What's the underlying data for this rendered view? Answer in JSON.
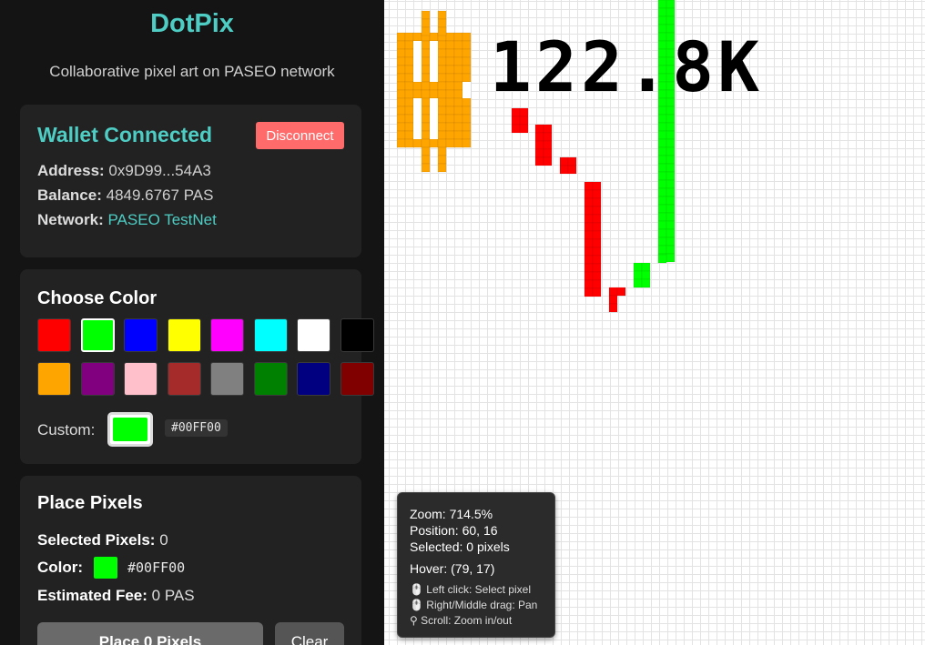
{
  "app": {
    "title": "DotPix",
    "subtitle": "Collaborative pixel art on PASEO network"
  },
  "wallet": {
    "title": "Wallet Connected",
    "disconnect_label": "Disconnect",
    "address_label": "Address:",
    "address_value": "0x9D99...54A3",
    "balance_label": "Balance:",
    "balance_value": "4849.6767 PAS",
    "network_label": "Network:",
    "network_value": "PASEO TestNet"
  },
  "color_picker": {
    "title": "Choose Color",
    "swatches": [
      "#ff0000",
      "#00ff00",
      "#0000ff",
      "#ffff00",
      "#ff00ff",
      "#00ffff",
      "#ffffff",
      "#000000",
      "#ffa500",
      "#800080",
      "#ffc0cb",
      "#a52a2a",
      "#808080",
      "#008000",
      "#000080",
      "#800000"
    ],
    "selected_color": "#00ff00",
    "custom_label": "Custom:",
    "custom_hex": "#00FF00"
  },
  "place": {
    "title": "Place Pixels",
    "selected_label": "Selected Pixels:",
    "selected_value": "0",
    "color_label": "Color:",
    "color_hex": "#00FF00",
    "fee_label": "Estimated Fee:",
    "fee_value": "0 PAS",
    "place_button_label": "Place 0 Pixels",
    "clear_button_label": "Clear"
  },
  "overlay": {
    "zoom": "Zoom: 714.5%",
    "position": "Position: 60, 16",
    "selected": "Selected: 0 pixels",
    "hover": "Hover: (79, 17)",
    "help_click": "🖱️ Left click: Select pixel",
    "help_drag": "🖱️ Right/Middle drag: Pan",
    "help_scroll": "⚲ Scroll: Zoom in/out"
  },
  "canvas_art": {
    "price_text": "122.8K",
    "colors": {
      "bitcoin": "#ffa500",
      "down": "#ff0000",
      "up": "#00ff00",
      "text": "#000000"
    }
  }
}
